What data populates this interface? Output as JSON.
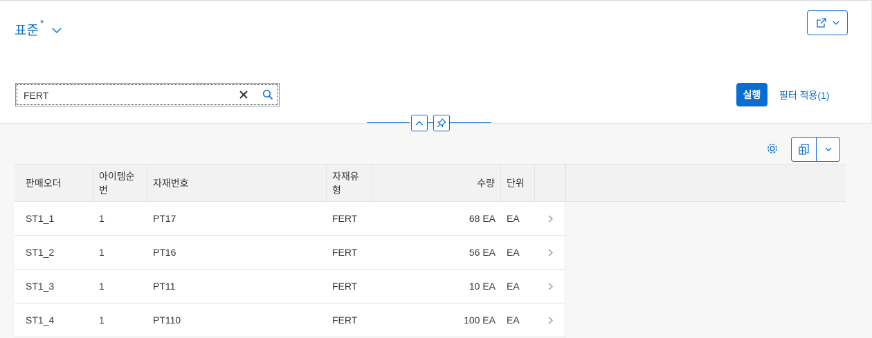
{
  "variant": {
    "title": "표준",
    "modified_marker": "*"
  },
  "search": {
    "value": "FERT"
  },
  "actions": {
    "go_label": "실행",
    "filter_label": "필터 적용(1)"
  },
  "table": {
    "columns": [
      "판매오더",
      "아이템순번",
      "자재번호",
      "자재유형",
      "수량",
      "단위"
    ],
    "rows": [
      [
        "ST1_1",
        "1",
        "PT17",
        "FERT",
        "68 EA",
        "EA"
      ],
      [
        "ST1_2",
        "1",
        "PT16",
        "FERT",
        "56 EA",
        "EA"
      ],
      [
        "ST1_3",
        "1",
        "PT11",
        "FERT",
        "10 EA",
        "EA"
      ],
      [
        "ST1_4",
        "1",
        "PT110",
        "FERT",
        "100 EA",
        "EA"
      ]
    ]
  },
  "colors": {
    "accent": "#0a6ed1",
    "text": "#32363a",
    "header_bg": "#f2f2f2"
  }
}
